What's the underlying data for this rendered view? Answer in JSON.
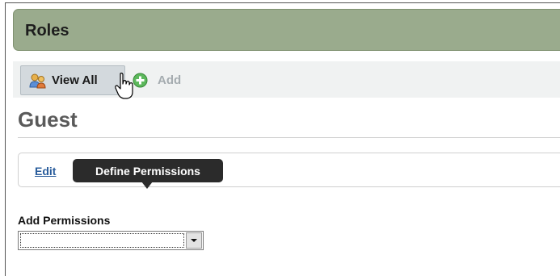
{
  "roles_header": {
    "title": "Roles"
  },
  "toolbar": {
    "view_all_label": "View All",
    "add_label": "Add",
    "view_all_icon": "users-icon",
    "add_icon": "plus-circle-icon"
  },
  "role": {
    "name": "Guest"
  },
  "actions": {
    "edit_label": "Edit",
    "tooltip": "Define Permissions"
  },
  "permissions": {
    "label": "Add Permissions",
    "selected_value": ""
  },
  "colors": {
    "header_bg": "#9aab8d",
    "toolbar_bg": "#f0f2f2",
    "link": "#2a5d9c",
    "tooltip_bg": "#2b2b2b",
    "add_icon": "#5cb85c"
  }
}
